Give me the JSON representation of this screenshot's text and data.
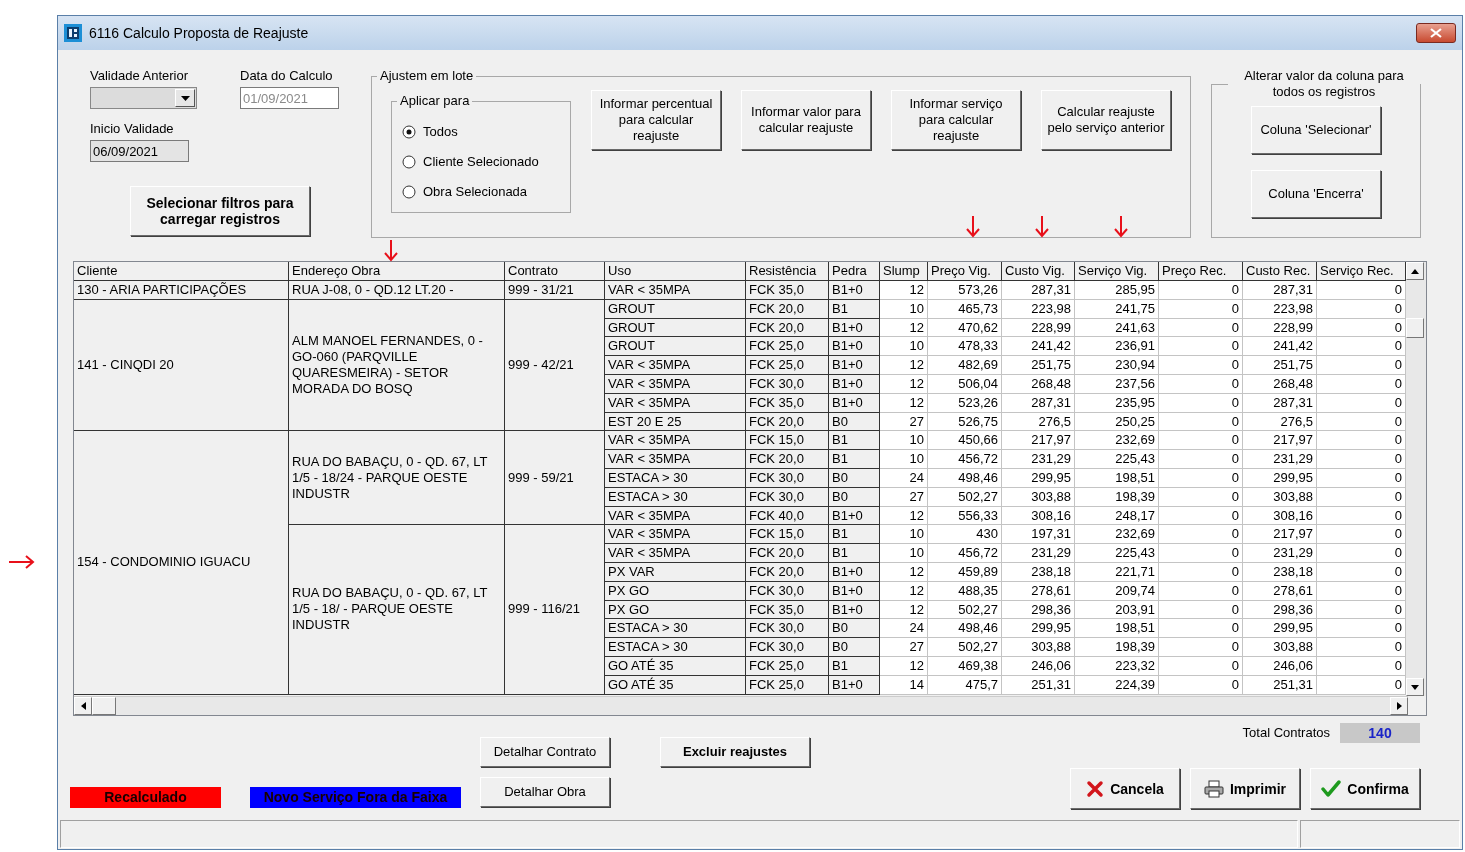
{
  "window": {
    "title": "6116 Calculo Proposta de Reajuste"
  },
  "filters": {
    "validade_anterior": {
      "label": "Validade Anterior"
    },
    "data_calculo": {
      "label": "Data do Calculo",
      "value": "01/09/2021",
      "disabled": true
    },
    "inicio_validade": {
      "label": "Inicio Validade",
      "value": "06/09/2021"
    },
    "load_button": "Selecionar filtros para carregar registros"
  },
  "batch_group": {
    "title": "Ajustem em lote",
    "apply_group": {
      "title": "Aplicar para",
      "options": [
        {
          "label": "Todos",
          "selected": true
        },
        {
          "label": "Cliente Selecionado",
          "selected": false
        },
        {
          "label": "Obra Selecionada",
          "selected": false
        }
      ]
    },
    "buttons": [
      "Informar percentual para calcular reajuste",
      "Informar valor para calcular reajuste",
      "Informar serviço para calcular reajuste",
      "Calcular reajuste pelo serviço anterior"
    ]
  },
  "column_group": {
    "title": "Alterar valor da coluna para todos os registros",
    "buttons": [
      "Coluna 'Selecionar'",
      "Coluna 'Encerra'"
    ]
  },
  "table": {
    "columns": [
      "Cliente",
      "Endereço Obra",
      "Contrato",
      "Uso",
      "Resistência",
      "Pedra",
      "Slump",
      "Preço Vig.",
      "Custo Vig.",
      "Serviço Vig.",
      "Preço Rec.",
      "Custo Rec.",
      "Serviço Rec."
    ],
    "clients": [
      {
        "name": "130 - ARIA PARTICIPAÇÕES",
        "obras": [
          {
            "address": "RUA J-08, 0 - QD.12 LT.20 -",
            "contract": "999 - 31/21",
            "rows": [
              [
                "VAR < 35MPA",
                "FCK 35,0",
                "B1+0",
                "12",
                "573,26",
                "287,31",
                "285,95",
                "0",
                "287,31",
                "0"
              ]
            ]
          }
        ]
      },
      {
        "name": "141 - CINQDI 20",
        "obras": [
          {
            "address": "ALM MANOEL FERNANDES, 0 - GO-060 (PARQVILLE QUARESMEIRA) - SETOR MORADA DO BOSQ",
            "contract": "999 - 42/21",
            "rows": [
              [
                "GROUT",
                "FCK 20,0",
                "B1",
                "10",
                "465,73",
                "223,98",
                "241,75",
                "0",
                "223,98",
                "0"
              ],
              [
                "GROUT",
                "FCK 20,0",
                "B1+0",
                "12",
                "470,62",
                "228,99",
                "241,63",
                "0",
                "228,99",
                "0"
              ],
              [
                "GROUT",
                "FCK 25,0",
                "B1+0",
                "10",
                "478,33",
                "241,42",
                "236,91",
                "0",
                "241,42",
                "0"
              ],
              [
                "VAR < 35MPA",
                "FCK 25,0",
                "B1+0",
                "12",
                "482,69",
                "251,75",
                "230,94",
                "0",
                "251,75",
                "0"
              ],
              [
                "VAR < 35MPA",
                "FCK 30,0",
                "B1+0",
                "12",
                "506,04",
                "268,48",
                "237,56",
                "0",
                "268,48",
                "0"
              ],
              [
                "VAR < 35MPA",
                "FCK 35,0",
                "B1+0",
                "12",
                "523,26",
                "287,31",
                "235,95",
                "0",
                "287,31",
                "0"
              ],
              [
                "EST 20 E 25",
                "FCK 20,0",
                "B0",
                "27",
                "526,75",
                "276,5",
                "250,25",
                "0",
                "276,5",
                "0"
              ]
            ]
          }
        ]
      },
      {
        "name": "154 - CONDOMINIO IGUACU",
        "obras": [
          {
            "address": "RUA DO BABAÇU, 0 - QD. 67, LT 1/5 - 18/24 - PARQUE OESTE INDUSTR",
            "contract": "999 - 59/21",
            "rows": [
              [
                "VAR < 35MPA",
                "FCK 15,0",
                "B1",
                "10",
                "450,66",
                "217,97",
                "232,69",
                "0",
                "217,97",
                "0"
              ],
              [
                "VAR < 35MPA",
                "FCK 20,0",
                "B1",
                "10",
                "456,72",
                "231,29",
                "225,43",
                "0",
                "231,29",
                "0"
              ],
              [
                "ESTACA > 30",
                "FCK 30,0",
                "B0",
                "24",
                "498,46",
                "299,95",
                "198,51",
                "0",
                "299,95",
                "0"
              ],
              [
                "ESTACA > 30",
                "FCK 30,0",
                "B0",
                "27",
                "502,27",
                "303,88",
                "198,39",
                "0",
                "303,88",
                "0"
              ],
              [
                "VAR < 35MPA",
                "FCK 40,0",
                "B1+0",
                "12",
                "556,33",
                "308,16",
                "248,17",
                "0",
                "308,16",
                "0"
              ]
            ]
          },
          {
            "address": "RUA DO BABAÇU, 0 - QD. 67, LT 1/5 - 18/ - PARQUE OESTE INDUSTR",
            "contract": "999 - 116/21",
            "rows": [
              [
                "VAR < 35MPA",
                "FCK 15,0",
                "B1",
                "10",
                "430",
                "197,31",
                "232,69",
                "0",
                "217,97",
                "0"
              ],
              [
                "VAR < 35MPA",
                "FCK 20,0",
                "B1",
                "10",
                "456,72",
                "231,29",
                "225,43",
                "0",
                "231,29",
                "0"
              ],
              [
                "PX VAR",
                "FCK 20,0",
                "B1+0",
                "12",
                "459,89",
                "238,18",
                "221,71",
                "0",
                "238,18",
                "0"
              ],
              [
                "PX GO",
                "FCK 30,0",
                "B1+0",
                "12",
                "488,35",
                "278,61",
                "209,74",
                "0",
                "278,61",
                "0"
              ],
              [
                "PX GO",
                "FCK 35,0",
                "B1+0",
                "12",
                "502,27",
                "298,36",
                "203,91",
                "0",
                "298,36",
                "0"
              ],
              [
                "ESTACA > 30",
                "FCK 30,0",
                "B0",
                "24",
                "498,46",
                "299,95",
                "198,51",
                "0",
                "299,95",
                "0"
              ],
              [
                "ESTACA > 30",
                "FCK 30,0",
                "B0",
                "27",
                "502,27",
                "303,88",
                "198,39",
                "0",
                "303,88",
                "0"
              ],
              [
                "GO ATÉ 35",
                "FCK 25,0",
                "B1",
                "12",
                "469,38",
                "246,06",
                "223,32",
                "0",
                "246,06",
                "0"
              ],
              [
                "GO ATÉ 35",
                "FCK 25,0",
                "B1+0",
                "14",
                "475,7",
                "251,31",
                "224,39",
                "0",
                "251,31",
                "0"
              ]
            ]
          }
        ]
      }
    ]
  },
  "legend": [
    {
      "label": "Recalculado",
      "color": "#ff0000"
    },
    {
      "label": "Novo Serviço Fora da Faixa",
      "color": "#0000ff"
    }
  ],
  "detail_buttons": [
    "Detalhar Contrato",
    "Detalhar Obra"
  ],
  "exclude_button": "Excluir reajustes",
  "total": {
    "label": "Total Contratos",
    "value": "140"
  },
  "actions": [
    {
      "kind": "cancel",
      "label": "Cancela"
    },
    {
      "kind": "print",
      "label": "Imprimir"
    },
    {
      "kind": "confirm",
      "label": "Confirma"
    }
  ]
}
